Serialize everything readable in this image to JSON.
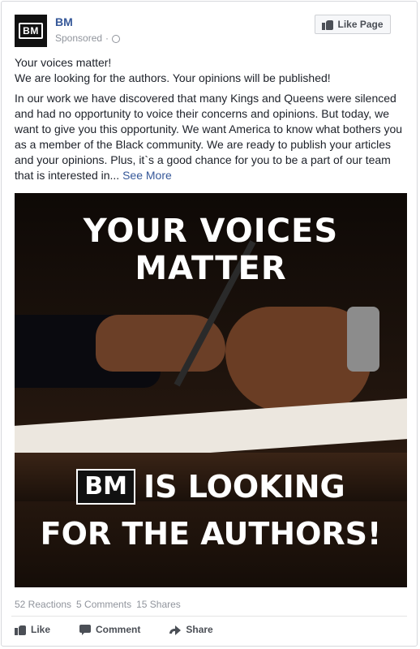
{
  "post": {
    "page_name": "BM",
    "avatar_text": "BM",
    "sponsored": "Sponsored",
    "separator": "·",
    "like_page_label": "Like Page",
    "text_line1": "Your voices matter!",
    "text_line2": "We are looking for the authors. Your opinions will be published!",
    "text_body": "In our work we have discovered that many Kings and Queens were silenced and had no opportunity to voice their concerns and opinions. But today, we want to give you this opportunity. We want America to know what bothers you as a member of the Black community. We are ready to publish your articles and your opinions. Plus, it`s a good chance for you to be a part of our team that is interested in...",
    "see_more": "See More"
  },
  "image": {
    "headline": "YOUR VOICES MATTER",
    "logo_text": "BM",
    "line1": "IS LOOKING",
    "line2": "FOR THE AUTHORS!"
  },
  "stats": {
    "reactions": "52 Reactions",
    "comments": "5 Comments",
    "shares": "15 Shares"
  },
  "actions": {
    "like": "Like",
    "comment": "Comment",
    "share": "Share"
  },
  "icons": {
    "thumb": "thumbs-up-icon",
    "comment": "comment-bubble-icon",
    "share": "share-arrow-icon",
    "globe": "globe-icon"
  },
  "colors": {
    "link": "#365899",
    "meta": "#90949c",
    "text": "#1d2129"
  }
}
